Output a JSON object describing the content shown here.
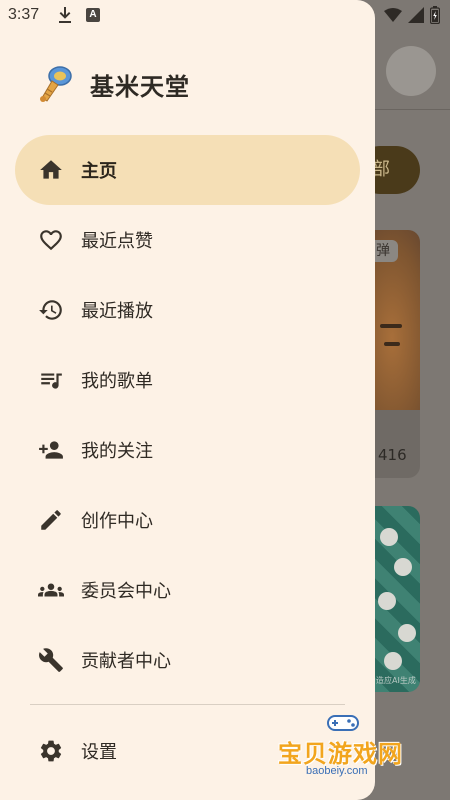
{
  "status_bar": {
    "time": "3:37",
    "icons": [
      "download-icon",
      "a-badge-icon",
      "wifi-icon",
      "signal-icon",
      "battery-icon"
    ],
    "a_badge": "A"
  },
  "drawer": {
    "app_title": "基米天堂",
    "logo_icon": "gift-logo-icon",
    "nav_items": [
      {
        "label": "主页",
        "icon": "home-icon",
        "active": true
      },
      {
        "label": "最近点赞",
        "icon": "heart-icon",
        "active": false
      },
      {
        "label": "最近播放",
        "icon": "history-icon",
        "active": false
      },
      {
        "label": "我的歌单",
        "icon": "playlist-icon",
        "active": false
      },
      {
        "label": "我的关注",
        "icon": "person-add-icon",
        "active": false
      },
      {
        "label": "创作中心",
        "icon": "pencil-icon",
        "active": false
      },
      {
        "label": "委员会中心",
        "icon": "group-icon",
        "active": false
      },
      {
        "label": "贡献者中心",
        "icon": "wrench-icon",
        "active": false
      }
    ],
    "settings": {
      "label": "设置",
      "icon": "gear-icon"
    },
    "colors": {
      "background": "#fdf2e6",
      "active_pill": "#f5dfb6",
      "text": "#2f2a24"
    }
  },
  "background": {
    "chip_label": "部",
    "card1_tag": "弹",
    "card1_count": "416",
    "card2_caption": "造应AI生成"
  },
  "watermark": {
    "text": "宝贝游戏网",
    "domain": "baobeiy.com"
  }
}
